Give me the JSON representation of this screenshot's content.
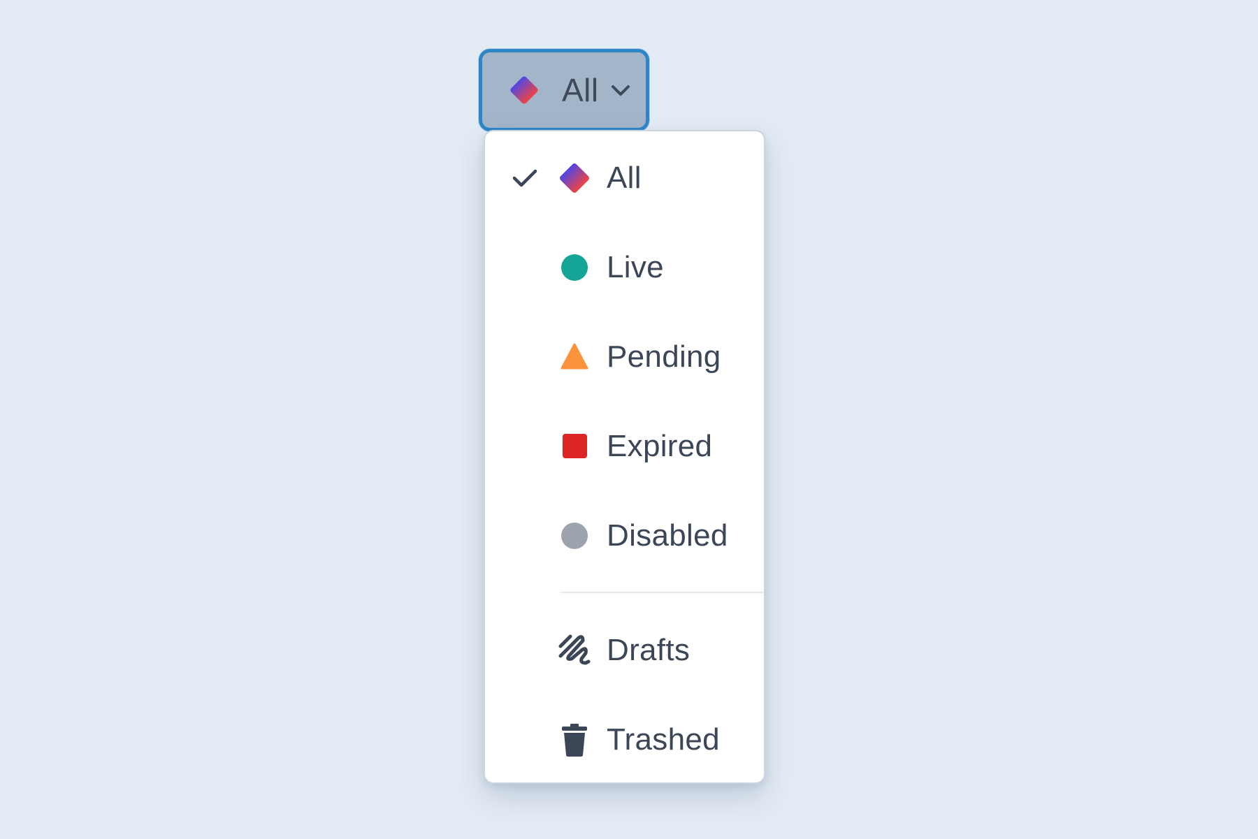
{
  "trigger": {
    "label": "All",
    "icon": "gradient-diamond-icon",
    "expand_icon": "chevron-down-icon"
  },
  "menu": {
    "selected": "All",
    "items": [
      {
        "label": "All",
        "icon": "gradient-diamond-icon",
        "checked": true
      },
      {
        "label": "Live",
        "icon": "circle-icon",
        "color": "#14a596"
      },
      {
        "label": "Pending",
        "icon": "triangle-icon",
        "color": "#fb923c"
      },
      {
        "label": "Expired",
        "icon": "square-icon",
        "color": "#dc2626"
      },
      {
        "label": "Disabled",
        "icon": "circle-icon",
        "color": "#9ca3af"
      },
      {
        "label": "Drafts",
        "icon": "scribble-icon",
        "color": "#3b4656"
      },
      {
        "label": "Trashed",
        "icon": "trash-icon",
        "color": "#3b4656"
      }
    ]
  },
  "colors": {
    "background": "#e3ebf5",
    "focus_ring": "#2f86c7",
    "text": "#3b4656",
    "diamond_gradient_start": "#4f46e5",
    "diamond_gradient_end": "#ef4444"
  }
}
